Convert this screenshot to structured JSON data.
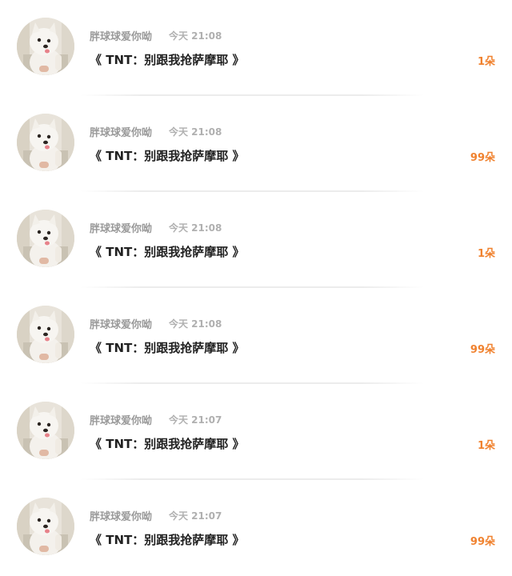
{
  "gifts": [
    {
      "sender": "胖球球爱你呦",
      "time": "今天 21:08",
      "message": "《 TNT：别跟我抢萨摩耶 》",
      "count": "1朵"
    },
    {
      "sender": "胖球球爱你呦",
      "time": "今天 21:08",
      "message": "《 TNT：别跟我抢萨摩耶 》",
      "count": "99朵"
    },
    {
      "sender": "胖球球爱你呦",
      "time": "今天 21:08",
      "message": "《 TNT：别跟我抢萨摩耶 》",
      "count": "1朵"
    },
    {
      "sender": "胖球球爱你呦",
      "time": "今天 21:08",
      "message": "《 TNT：别跟我抢萨摩耶 》",
      "count": "99朵"
    },
    {
      "sender": "胖球球爱你呦",
      "time": "今天 21:07",
      "message": "《 TNT：别跟我抢萨摩耶 》",
      "count": "1朵"
    },
    {
      "sender": "胖球球爱你呦",
      "time": "今天 21:07",
      "message": "《 TNT：别跟我抢萨摩耶 》",
      "count": "99朵"
    }
  ],
  "colors": {
    "count": "#f0822f",
    "sender": "#9a9a9a",
    "time": "#b0b0b0",
    "message": "#222222"
  },
  "icons": {
    "avatar": "samoyed-dog-avatar"
  }
}
